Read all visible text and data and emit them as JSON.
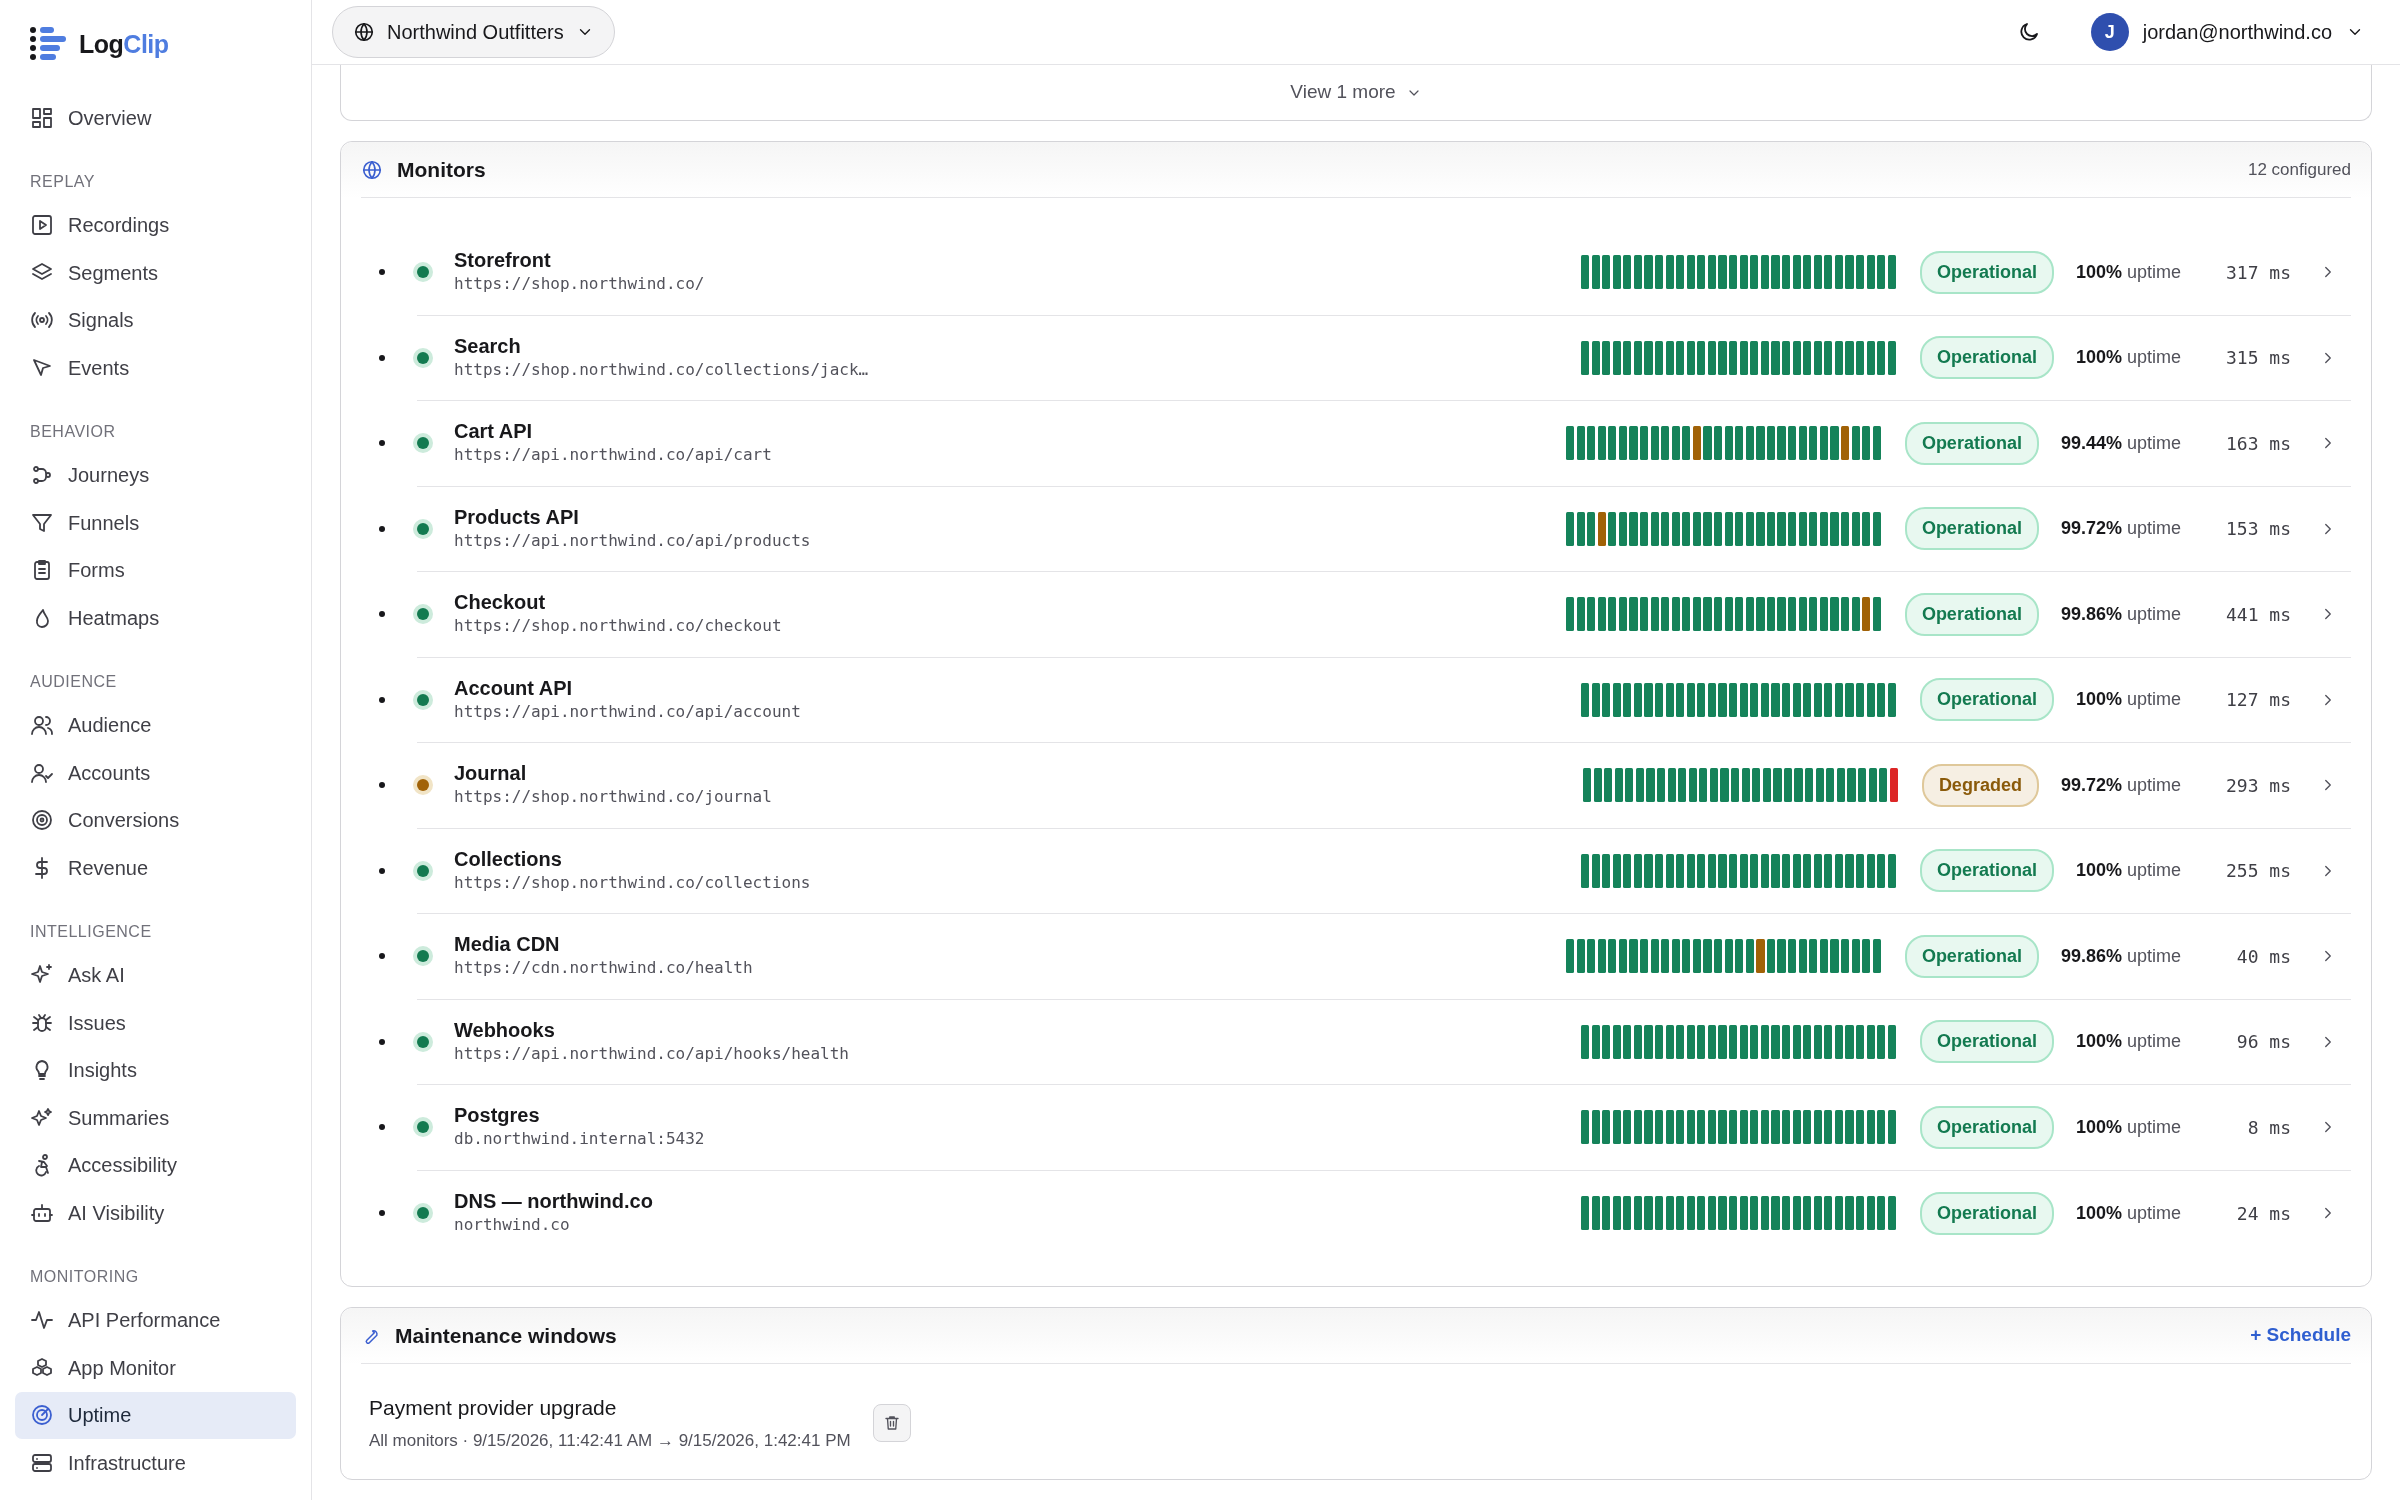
{
  "brand": {
    "name_part1": "Log",
    "name_part2": "Clip"
  },
  "sidebar": {
    "top_items": [
      {
        "label": "Overview",
        "selected": false
      }
    ],
    "sections": [
      {
        "title": "REPLAY",
        "items": [
          {
            "label": "Recordings",
            "selected": false
          },
          {
            "label": "Segments",
            "selected": false
          },
          {
            "label": "Signals",
            "selected": false
          },
          {
            "label": "Events",
            "selected": false
          }
        ]
      },
      {
        "title": "BEHAVIOR",
        "items": [
          {
            "label": "Journeys",
            "selected": false
          },
          {
            "label": "Funnels",
            "selected": false
          },
          {
            "label": "Forms",
            "selected": false
          },
          {
            "label": "Heatmaps",
            "selected": false
          }
        ]
      },
      {
        "title": "AUDIENCE",
        "items": [
          {
            "label": "Audience",
            "selected": false
          },
          {
            "label": "Accounts",
            "selected": false
          },
          {
            "label": "Conversions",
            "selected": false
          },
          {
            "label": "Revenue",
            "selected": false
          }
        ]
      },
      {
        "title": "INTELLIGENCE",
        "items": [
          {
            "label": "Ask AI",
            "selected": false
          },
          {
            "label": "Issues",
            "selected": false
          },
          {
            "label": "Insights",
            "selected": false
          },
          {
            "label": "Summaries",
            "selected": false
          },
          {
            "label": "Accessibility",
            "selected": false
          },
          {
            "label": "AI Visibility",
            "selected": false
          }
        ]
      },
      {
        "title": "MONITORING",
        "items": [
          {
            "label": "API Performance",
            "selected": false
          },
          {
            "label": "App Monitor",
            "selected": false
          },
          {
            "label": "Uptime",
            "selected": true
          },
          {
            "label": "Infrastructure",
            "selected": false
          }
        ]
      }
    ]
  },
  "header": {
    "workspace": "Northwind Outfitters",
    "avatar_letter": "J",
    "user": "jordan@northwind.co"
  },
  "previous_card": {
    "more_link": "View 1 more"
  },
  "monitors": {
    "title": "Monitors",
    "count": "12 configured",
    "items": [
      {
        "name": "Storefront",
        "url": "https://shop.northwind.co/",
        "kind": "operational",
        "status": "Operational",
        "uptime": "**100%** uptime",
        "latency": "317 ms",
        "history": [
          {
            "kind": "up"
          },
          {
            "kind": "up"
          },
          {
            "kind": "up"
          },
          {
            "kind": "up"
          },
          {
            "kind": "up"
          },
          {
            "kind": "up"
          },
          {
            "kind": "up"
          },
          {
            "kind": "up"
          },
          {
            "kind": "up"
          },
          {
            "kind": "up"
          },
          {
            "kind": "up"
          },
          {
            "kind": "up"
          },
          {
            "kind": "up"
          },
          {
            "kind": "up"
          },
          {
            "kind": "up"
          },
          {
            "kind": "up"
          },
          {
            "kind": "up"
          },
          {
            "kind": "up"
          },
          {
            "kind": "up"
          },
          {
            "kind": "up"
          },
          {
            "kind": "up"
          },
          {
            "kind": "up"
          },
          {
            "kind": "up"
          },
          {
            "kind": "up"
          },
          {
            "kind": "up"
          },
          {
            "kind": "up"
          },
          {
            "kind": "up"
          },
          {
            "kind": "up"
          },
          {
            "kind": "up"
          },
          {
            "kind": "up"
          }
        ]
      },
      {
        "name": "Search",
        "url": "https://shop.northwind.co/collections/jack…",
        "kind": "operational",
        "status": "Operational",
        "uptime": "**100%** uptime",
        "latency": "315 ms",
        "history": [
          {
            "kind": "up"
          },
          {
            "kind": "up"
          },
          {
            "kind": "up"
          },
          {
            "kind": "up"
          },
          {
            "kind": "up"
          },
          {
            "kind": "up"
          },
          {
            "kind": "up"
          },
          {
            "kind": "up"
          },
          {
            "kind": "up"
          },
          {
            "kind": "up"
          },
          {
            "kind": "up"
          },
          {
            "kind": "up"
          },
          {
            "kind": "up"
          },
          {
            "kind": "up"
          },
          {
            "kind": "up"
          },
          {
            "kind": "up"
          },
          {
            "kind": "up"
          },
          {
            "kind": "up"
          },
          {
            "kind": "up"
          },
          {
            "kind": "up"
          },
          {
            "kind": "up"
          },
          {
            "kind": "up"
          },
          {
            "kind": "up"
          },
          {
            "kind": "up"
          },
          {
            "kind": "up"
          },
          {
            "kind": "up"
          },
          {
            "kind": "up"
          },
          {
            "kind": "up"
          },
          {
            "kind": "up"
          },
          {
            "kind": "up"
          }
        ]
      },
      {
        "name": "Cart API",
        "url": "https://api.northwind.co/api/cart",
        "kind": "operational",
        "status": "Operational",
        "uptime": "**99.44%** uptime",
        "latency": "163 ms",
        "history": [
          {
            "kind": "up"
          },
          {
            "kind": "up"
          },
          {
            "kind": "up"
          },
          {
            "kind": "up"
          },
          {
            "kind": "up"
          },
          {
            "kind": "up"
          },
          {
            "kind": "up"
          },
          {
            "kind": "up"
          },
          {
            "kind": "up"
          },
          {
            "kind": "up"
          },
          {
            "kind": "up"
          },
          {
            "kind": "up"
          },
          {
            "kind": "warn"
          },
          {
            "kind": "up"
          },
          {
            "kind": "up"
          },
          {
            "kind": "up"
          },
          {
            "kind": "up"
          },
          {
            "kind": "up"
          },
          {
            "kind": "up"
          },
          {
            "kind": "up"
          },
          {
            "kind": "up"
          },
          {
            "kind": "up"
          },
          {
            "kind": "up"
          },
          {
            "kind": "up"
          },
          {
            "kind": "up"
          },
          {
            "kind": "up"
          },
          {
            "kind": "warn"
          },
          {
            "kind": "up"
          },
          {
            "kind": "up"
          },
          {
            "kind": "up"
          }
        ]
      },
      {
        "name": "Products API",
        "url": "https://api.northwind.co/api/products",
        "kind": "operational",
        "status": "Operational",
        "uptime": "**99.72%** uptime",
        "latency": "153 ms",
        "history": [
          {
            "kind": "up"
          },
          {
            "kind": "up"
          },
          {
            "kind": "up"
          },
          {
            "kind": "warn"
          },
          {
            "kind": "up"
          },
          {
            "kind": "up"
          },
          {
            "kind": "up"
          },
          {
            "kind": "up"
          },
          {
            "kind": "up"
          },
          {
            "kind": "up"
          },
          {
            "kind": "up"
          },
          {
            "kind": "up"
          },
          {
            "kind": "up"
          },
          {
            "kind": "up"
          },
          {
            "kind": "up"
          },
          {
            "kind": "up"
          },
          {
            "kind": "up"
          },
          {
            "kind": "up"
          },
          {
            "kind": "up"
          },
          {
            "kind": "up"
          },
          {
            "kind": "up"
          },
          {
            "kind": "up"
          },
          {
            "kind": "up"
          },
          {
            "kind": "up"
          },
          {
            "kind": "up"
          },
          {
            "kind": "up"
          },
          {
            "kind": "up"
          },
          {
            "kind": "up"
          },
          {
            "kind": "up"
          },
          {
            "kind": "up"
          }
        ]
      },
      {
        "name": "Checkout",
        "url": "https://shop.northwind.co/checkout",
        "kind": "operational",
        "status": "Operational",
        "uptime": "**99.86%** uptime",
        "latency": "441 ms",
        "history": [
          {
            "kind": "up"
          },
          {
            "kind": "up"
          },
          {
            "kind": "up"
          },
          {
            "kind": "up"
          },
          {
            "kind": "up"
          },
          {
            "kind": "up"
          },
          {
            "kind": "up"
          },
          {
            "kind": "up"
          },
          {
            "kind": "up"
          },
          {
            "kind": "up"
          },
          {
            "kind": "up"
          },
          {
            "kind": "up"
          },
          {
            "kind": "up"
          },
          {
            "kind": "up"
          },
          {
            "kind": "up"
          },
          {
            "kind": "up"
          },
          {
            "kind": "up"
          },
          {
            "kind": "up"
          },
          {
            "kind": "up"
          },
          {
            "kind": "up"
          },
          {
            "kind": "up"
          },
          {
            "kind": "up"
          },
          {
            "kind": "up"
          },
          {
            "kind": "up"
          },
          {
            "kind": "up"
          },
          {
            "kind": "up"
          },
          {
            "kind": "up"
          },
          {
            "kind": "up"
          },
          {
            "kind": "warn"
          },
          {
            "kind": "up"
          }
        ]
      },
      {
        "name": "Account API",
        "url": "https://api.northwind.co/api/account",
        "kind": "operational",
        "status": "Operational",
        "uptime": "**100%** uptime",
        "latency": "127 ms",
        "history": [
          {
            "kind": "up"
          },
          {
            "kind": "up"
          },
          {
            "kind": "up"
          },
          {
            "kind": "up"
          },
          {
            "kind": "up"
          },
          {
            "kind": "up"
          },
          {
            "kind": "up"
          },
          {
            "kind": "up"
          },
          {
            "kind": "up"
          },
          {
            "kind": "up"
          },
          {
            "kind": "up"
          },
          {
            "kind": "up"
          },
          {
            "kind": "up"
          },
          {
            "kind": "up"
          },
          {
            "kind": "up"
          },
          {
            "kind": "up"
          },
          {
            "kind": "up"
          },
          {
            "kind": "up"
          },
          {
            "kind": "up"
          },
          {
            "kind": "up"
          },
          {
            "kind": "up"
          },
          {
            "kind": "up"
          },
          {
            "kind": "up"
          },
          {
            "kind": "up"
          },
          {
            "kind": "up"
          },
          {
            "kind": "up"
          },
          {
            "kind": "up"
          },
          {
            "kind": "up"
          },
          {
            "kind": "up"
          },
          {
            "kind": "up"
          }
        ]
      },
      {
        "name": "Journal",
        "url": "https://shop.northwind.co/journal",
        "kind": "degraded",
        "status": "Degraded",
        "uptime": "**99.72%** uptime",
        "latency": "293 ms",
        "history": [
          {
            "kind": "up"
          },
          {
            "kind": "up"
          },
          {
            "kind": "up"
          },
          {
            "kind": "up"
          },
          {
            "kind": "up"
          },
          {
            "kind": "up"
          },
          {
            "kind": "up"
          },
          {
            "kind": "up"
          },
          {
            "kind": "up"
          },
          {
            "kind": "up"
          },
          {
            "kind": "up"
          },
          {
            "kind": "up"
          },
          {
            "kind": "up"
          },
          {
            "kind": "up"
          },
          {
            "kind": "up"
          },
          {
            "kind": "up"
          },
          {
            "kind": "up"
          },
          {
            "kind": "up"
          },
          {
            "kind": "up"
          },
          {
            "kind": "up"
          },
          {
            "kind": "up"
          },
          {
            "kind": "up"
          },
          {
            "kind": "up"
          },
          {
            "kind": "up"
          },
          {
            "kind": "up"
          },
          {
            "kind": "up"
          },
          {
            "kind": "up"
          },
          {
            "kind": "up"
          },
          {
            "kind": "up"
          },
          {
            "kind": "down"
          }
        ]
      },
      {
        "name": "Collections",
        "url": "https://shop.northwind.co/collections",
        "kind": "operational",
        "status": "Operational",
        "uptime": "**100%** uptime",
        "latency": "255 ms",
        "history": [
          {
            "kind": "up"
          },
          {
            "kind": "up"
          },
          {
            "kind": "up"
          },
          {
            "kind": "up"
          },
          {
            "kind": "up"
          },
          {
            "kind": "up"
          },
          {
            "kind": "up"
          },
          {
            "kind": "up"
          },
          {
            "kind": "up"
          },
          {
            "kind": "up"
          },
          {
            "kind": "up"
          },
          {
            "kind": "up"
          },
          {
            "kind": "up"
          },
          {
            "kind": "up"
          },
          {
            "kind": "up"
          },
          {
            "kind": "up"
          },
          {
            "kind": "up"
          },
          {
            "kind": "up"
          },
          {
            "kind": "up"
          },
          {
            "kind": "up"
          },
          {
            "kind": "up"
          },
          {
            "kind": "up"
          },
          {
            "kind": "up"
          },
          {
            "kind": "up"
          },
          {
            "kind": "up"
          },
          {
            "kind": "up"
          },
          {
            "kind": "up"
          },
          {
            "kind": "up"
          },
          {
            "kind": "up"
          },
          {
            "kind": "up"
          }
        ]
      },
      {
        "name": "Media CDN",
        "url": "https://cdn.northwind.co/health",
        "kind": "operational",
        "status": "Operational",
        "uptime": "**99.86%** uptime",
        "latency": "40 ms",
        "history": [
          {
            "kind": "up"
          },
          {
            "kind": "up"
          },
          {
            "kind": "up"
          },
          {
            "kind": "up"
          },
          {
            "kind": "up"
          },
          {
            "kind": "up"
          },
          {
            "kind": "up"
          },
          {
            "kind": "up"
          },
          {
            "kind": "up"
          },
          {
            "kind": "up"
          },
          {
            "kind": "up"
          },
          {
            "kind": "up"
          },
          {
            "kind": "up"
          },
          {
            "kind": "up"
          },
          {
            "kind": "up"
          },
          {
            "kind": "up"
          },
          {
            "kind": "up"
          },
          {
            "kind": "up"
          },
          {
            "kind": "warn"
          },
          {
            "kind": "up"
          },
          {
            "kind": "up"
          },
          {
            "kind": "up"
          },
          {
            "kind": "up"
          },
          {
            "kind": "up"
          },
          {
            "kind": "up"
          },
          {
            "kind": "up"
          },
          {
            "kind": "up"
          },
          {
            "kind": "up"
          },
          {
            "kind": "up"
          },
          {
            "kind": "up"
          }
        ]
      },
      {
        "name": "Webhooks",
        "url": "https://api.northwind.co/api/hooks/health",
        "kind": "operational",
        "status": "Operational",
        "uptime": "**100%** uptime",
        "latency": "96 ms",
        "history": [
          {
            "kind": "up"
          },
          {
            "kind": "up"
          },
          {
            "kind": "up"
          },
          {
            "kind": "up"
          },
          {
            "kind": "up"
          },
          {
            "kind": "up"
          },
          {
            "kind": "up"
          },
          {
            "kind": "up"
          },
          {
            "kind": "up"
          },
          {
            "kind": "up"
          },
          {
            "kind": "up"
          },
          {
            "kind": "up"
          },
          {
            "kind": "up"
          },
          {
            "kind": "up"
          },
          {
            "kind": "up"
          },
          {
            "kind": "up"
          },
          {
            "kind": "up"
          },
          {
            "kind": "up"
          },
          {
            "kind": "up"
          },
          {
            "kind": "up"
          },
          {
            "kind": "up"
          },
          {
            "kind": "up"
          },
          {
            "kind": "up"
          },
          {
            "kind": "up"
          },
          {
            "kind": "up"
          },
          {
            "kind": "up"
          },
          {
            "kind": "up"
          },
          {
            "kind": "up"
          },
          {
            "kind": "up"
          },
          {
            "kind": "up"
          }
        ]
      },
      {
        "name": "Postgres",
        "url": "db.northwind.internal:5432",
        "kind": "operational",
        "status": "Operational",
        "uptime": "**100%** uptime",
        "latency": "8 ms",
        "history": [
          {
            "kind": "up"
          },
          {
            "kind": "up"
          },
          {
            "kind": "up"
          },
          {
            "kind": "up"
          },
          {
            "kind": "up"
          },
          {
            "kind": "up"
          },
          {
            "kind": "up"
          },
          {
            "kind": "up"
          },
          {
            "kind": "up"
          },
          {
            "kind": "up"
          },
          {
            "kind": "up"
          },
          {
            "kind": "up"
          },
          {
            "kind": "up"
          },
          {
            "kind": "up"
          },
          {
            "kind": "up"
          },
          {
            "kind": "up"
          },
          {
            "kind": "up"
          },
          {
            "kind": "up"
          },
          {
            "kind": "up"
          },
          {
            "kind": "up"
          },
          {
            "kind": "up"
          },
          {
            "kind": "up"
          },
          {
            "kind": "up"
          },
          {
            "kind": "up"
          },
          {
            "kind": "up"
          },
          {
            "kind": "up"
          },
          {
            "kind": "up"
          },
          {
            "kind": "up"
          },
          {
            "kind": "up"
          },
          {
            "kind": "up"
          }
        ]
      },
      {
        "name": "DNS — northwind.co",
        "url": "northwind.co",
        "kind": "operational",
        "status": "Operational",
        "uptime": "**100%** uptime",
        "latency": "24 ms",
        "history": [
          {
            "kind": "up"
          },
          {
            "kind": "up"
          },
          {
            "kind": "up"
          },
          {
            "kind": "up"
          },
          {
            "kind": "up"
          },
          {
            "kind": "up"
          },
          {
            "kind": "up"
          },
          {
            "kind": "up"
          },
          {
            "kind": "up"
          },
          {
            "kind": "up"
          },
          {
            "kind": "up"
          },
          {
            "kind": "up"
          },
          {
            "kind": "up"
          },
          {
            "kind": "up"
          },
          {
            "kind": "up"
          },
          {
            "kind": "up"
          },
          {
            "kind": "up"
          },
          {
            "kind": "up"
          },
          {
            "kind": "up"
          },
          {
            "kind": "up"
          },
          {
            "kind": "up"
          },
          {
            "kind": "up"
          },
          {
            "kind": "up"
          },
          {
            "kind": "up"
          },
          {
            "kind": "up"
          },
          {
            "kind": "up"
          },
          {
            "kind": "up"
          },
          {
            "kind": "up"
          },
          {
            "kind": "up"
          },
          {
            "kind": "up"
          }
        ]
      }
    ]
  },
  "maintenance": {
    "title": "Maintenance windows",
    "schedule_button": "+ Schedule",
    "items": [
      {
        "title": "Payment provider upgrade",
        "detail": "All monitors · 9/15/2026, 11:42:41 AM → 9/15/2026, 1:42:41 PM"
      }
    ]
  }
}
